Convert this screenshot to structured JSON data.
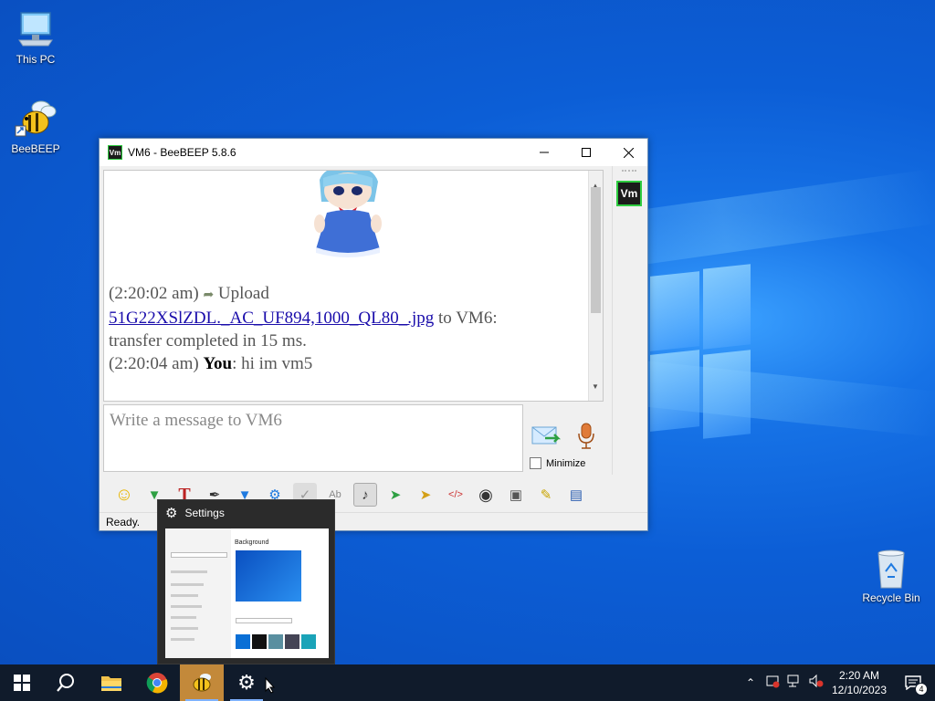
{
  "desktop": {
    "icons": [
      {
        "label": "This PC"
      },
      {
        "label": "BeeBEEP"
      },
      {
        "label": "Recycle Bin"
      }
    ]
  },
  "window": {
    "app_icon_text": "Vm",
    "title": "VM6 - BeeBEEP 5.8.6",
    "chat": {
      "line1_time": "(2:20:02 am)",
      "line1_text": "Upload",
      "line1_file": "51G22XSlZDL._AC_UF894,1000_QL80_.jpg",
      "line1_rest": "to VM6:",
      "line2": "transfer completed in 15 ms.",
      "line3_time": "(2:20:04 am)",
      "line3_user": "You",
      "line3_msg": ": hi im vm5"
    },
    "compose_placeholder": "Write a message to VM6",
    "minimize_label": "Minimize",
    "user_badge": "Vm",
    "status": "Ready."
  },
  "preview": {
    "title": "Settings",
    "thumb_heading": "Background"
  },
  "taskbar": {
    "time": "2:20 AM",
    "date": "12/10/2023",
    "notification_count": "4"
  },
  "colors": {
    "accent_link": "#1a0dab",
    "taskbar": "#101b2b",
    "user_status": "#2ecc40"
  }
}
